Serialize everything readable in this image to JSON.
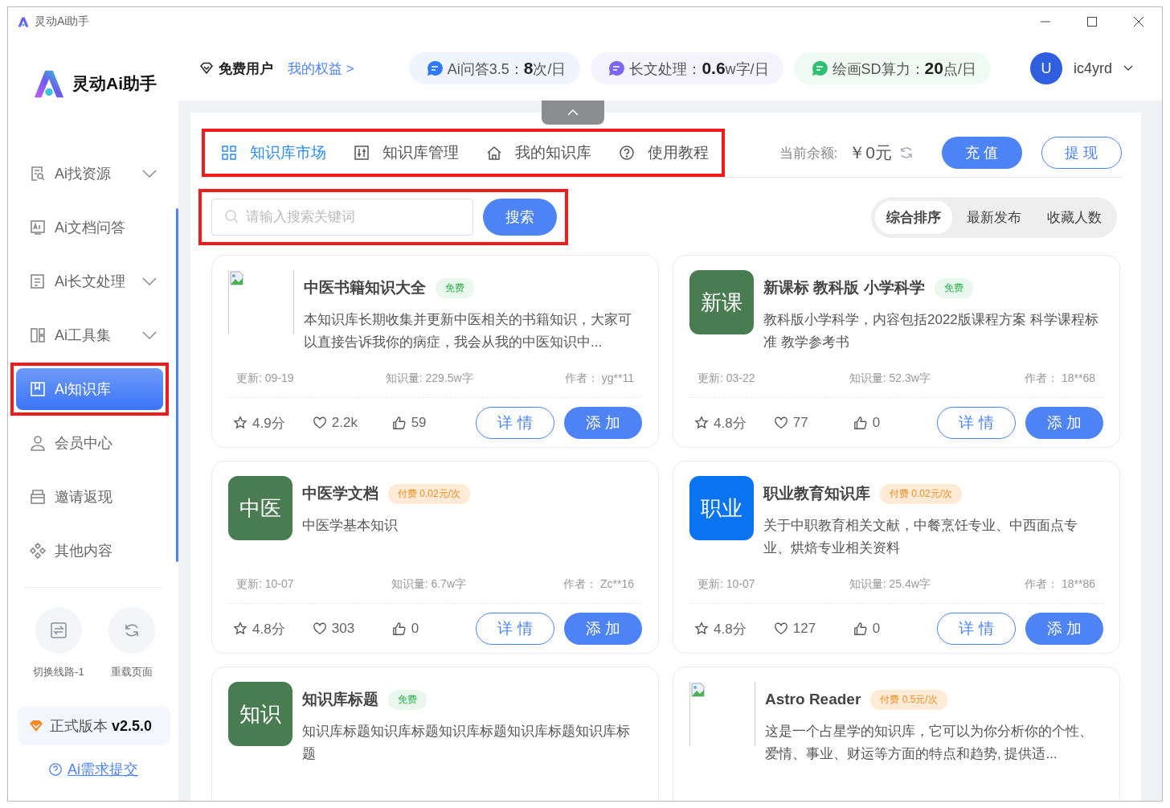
{
  "window": {
    "title": "灵动Ai助手"
  },
  "sidebar": {
    "brand": "灵动Ai助手",
    "items": [
      {
        "label": "Ai找资源",
        "expandable": true,
        "selected": false,
        "highlighted": false
      },
      {
        "label": "Ai文档问答",
        "expandable": false,
        "selected": false,
        "highlighted": false
      },
      {
        "label": "Ai长文处理",
        "expandable": true,
        "selected": false,
        "highlighted": false
      },
      {
        "label": "Ai工具集",
        "expandable": true,
        "selected": false,
        "highlighted": false
      },
      {
        "label": "Ai知识库",
        "expandable": false,
        "selected": true,
        "highlighted": true
      },
      {
        "label": "会员中心",
        "expandable": false,
        "selected": false,
        "highlighted": false
      },
      {
        "label": "邀请返现",
        "expandable": false,
        "selected": false,
        "highlighted": false
      },
      {
        "label": "其他内容",
        "expandable": false,
        "selected": false,
        "highlighted": false
      }
    ],
    "actions": [
      {
        "label": "切换线路-1"
      },
      {
        "label": "重载页面"
      }
    ],
    "version": "正式版本 **v2.5.0**",
    "feedback_link": "Ai需求提交"
  },
  "header": {
    "user_level": "免费用户",
    "benefits_link": "我的权益 >",
    "quotas": [
      {
        "text": "Ai问答3.5：**8**次/日",
        "color": "#2f7bf5"
      },
      {
        "text": "长文处理：**0.6**w字/日",
        "color": "#7b68ee"
      },
      {
        "text": "绘画SD算力：**20**点/日",
        "color": "#2fbf71"
      }
    ],
    "user": {
      "avatar": "U",
      "name": "ic4yrd"
    }
  },
  "tab_bar": {
    "highlighted": true,
    "tabs": [
      {
        "label": "知识库市场",
        "selected": true
      },
      {
        "label": "知识库管理",
        "selected": false
      },
      {
        "label": "我的知识库",
        "selected": false
      },
      {
        "label": "使用教程",
        "selected": false
      }
    ]
  },
  "balance": {
    "label": "当前余额:",
    "value": "￥0元"
  },
  "buttons": {
    "recharge": "充 值",
    "withdraw": "提 现"
  },
  "search": {
    "placeholder": "请输入搜索关键词",
    "button": "搜索",
    "highlighted": true
  },
  "sort_tabs": [
    {
      "label": "综合排序",
      "selected": true
    },
    {
      "label": "最新发布",
      "selected": false
    },
    {
      "label": "收藏人数",
      "selected": false
    }
  ],
  "cards": [
    {
      "title": "中医书籍知识大全",
      "thumb": {
        "kind": "broken"
      },
      "tag": {
        "kind": "free",
        "text": "免费"
      },
      "description": "本知识库长期收集并更新中医相关的书籍知识，大家可以直接告诉我你的病症，我会从我的中医知识中...",
      "updated": "更新: 09-19",
      "size": "知识量: 229.5w字",
      "author": "作者：  yg**11",
      "rating": "4.9分",
      "likes": "2.2k",
      "thumbs": "59",
      "detail": "详 情",
      "add": "添 加"
    },
    {
      "title": "新课标 教科版 小学科学",
      "thumb": {
        "kind": "text",
        "text": "新课",
        "color": "#4a7c52"
      },
      "tag": {
        "kind": "free",
        "text": "免费"
      },
      "description": "教科版小学科学，内容包括2022版课程方案 科学课程标准 教学参考书",
      "updated": "更新: 03-22",
      "size": "知识量: 52.3w字",
      "author": "作者：  18**68",
      "rating": "4.8分",
      "likes": "77",
      "thumbs": "0",
      "detail": "详 情",
      "add": "添 加"
    },
    {
      "title": "中医学文档",
      "thumb": {
        "kind": "text",
        "text": "中医",
        "color": "#4a7c52"
      },
      "tag": {
        "kind": "paid",
        "text": "付费 0.02元/次"
      },
      "description": "中医学基本知识",
      "updated": "更新: 10-07",
      "size": "知识量: 6.7w字",
      "author": "作者：  Zc**16",
      "rating": "4.8分",
      "likes": "303",
      "thumbs": "0",
      "detail": "详 情",
      "add": "添 加"
    },
    {
      "title": "职业教育知识库",
      "thumb": {
        "kind": "text",
        "text": "职业",
        "color": "#0a73f0"
      },
      "tag": {
        "kind": "paid",
        "text": "付费 0.02元/次"
      },
      "description": "关于中职教育相关文献，中餐烹饪专业、中西面点专业、烘焙专业相关资料",
      "updated": "更新: 10-07",
      "size": "知识量: 25.4w字",
      "author": "作者：  18**86",
      "rating": "4.8分",
      "likes": "127",
      "thumbs": "0",
      "detail": "详 情",
      "add": "添 加"
    },
    {
      "title": "知识库标题",
      "thumb": {
        "kind": "text",
        "text": "知识",
        "color": "#4a7c52"
      },
      "tag": {
        "kind": "free",
        "text": "免费"
      },
      "description": "知识库标题知识库标题知识库标题知识库标题知识库标题"
    },
    {
      "title": "Astro Reader",
      "thumb": {
        "kind": "broken"
      },
      "tag": {
        "kind": "paid",
        "text": "付费 0.5元/次"
      },
      "description": "这是一个占星学的知识库，它可以为你分析你的个性、爱情、事业、财运等方面的特点和趋势, 提供适..."
    }
  ]
}
